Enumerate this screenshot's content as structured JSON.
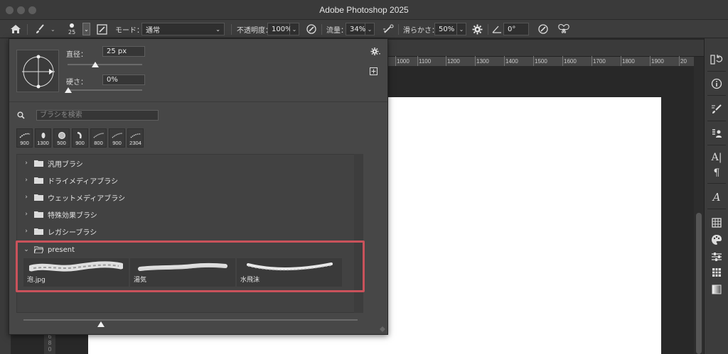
{
  "app": {
    "title": "Adobe Photoshop 2025"
  },
  "options_bar": {
    "brush_size": "25",
    "mode_label": "モード：",
    "mode_value": "通常",
    "opacity_label": "不透明度：",
    "opacity_value": "100%",
    "flow_label": "流量：",
    "flow_value": "34%",
    "smoothing_label": "滑らかさ：",
    "smoothing_value": "50%",
    "angle_value": "0°"
  },
  "ruler": {
    "ticks": [
      "1000",
      "1100",
      "1200",
      "1300",
      "1400",
      "1500",
      "1600",
      "1700",
      "1800",
      "1900",
      "20"
    ]
  },
  "left_ruler_digits": [
    "6",
    "8",
    "0"
  ],
  "brush_popup": {
    "size_label": "直径：",
    "size_value": "25 px",
    "hardness_label": "硬さ：",
    "hardness_value": "0%",
    "search_placeholder": "ブラシを検索",
    "recent_sizes": [
      "900",
      "1300",
      "500",
      "900",
      "800",
      "900",
      "2304"
    ],
    "folders": [
      {
        "label": "汎用ブラシ"
      },
      {
        "label": "ドライメディアブラシ"
      },
      {
        "label": "ウェットメディアブラシ"
      },
      {
        "label": "特殊効果ブラシ"
      },
      {
        "label": "レガシーブラシ"
      }
    ],
    "open_folder": {
      "label": "present",
      "brushes": [
        {
          "name": "泡.jpg"
        },
        {
          "name": "湯気"
        },
        {
          "name": "水飛沫"
        }
      ]
    }
  },
  "colors": {
    "highlight": "#c9525b",
    "panel": "#474747",
    "canvas": "#ffffff"
  }
}
